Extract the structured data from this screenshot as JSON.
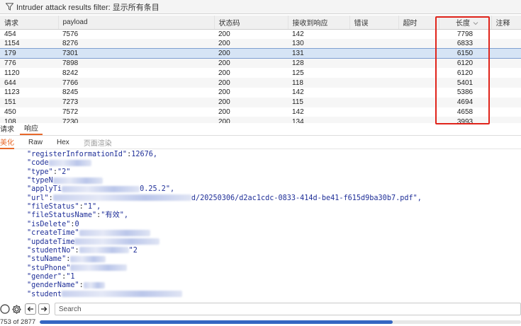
{
  "filter": {
    "icon": "funnel-icon",
    "label": "Intruder attack results filter: 显示所有条目"
  },
  "table": {
    "headers": [
      "请求",
      "payload",
      "状态码",
      "接收到响应",
      "错误",
      "超时",
      "长度",
      "注释"
    ],
    "sort_column": "长度",
    "sort_direction": "descending",
    "rows": [
      [
        "454",
        "7576",
        "200",
        "142",
        "",
        "",
        "7798",
        ""
      ],
      [
        "1154",
        "8276",
        "200",
        "130",
        "",
        "",
        "6833",
        ""
      ],
      [
        "179",
        "7301",
        "200",
        "131",
        "",
        "",
        "6150",
        ""
      ],
      [
        "776",
        "7898",
        "200",
        "128",
        "",
        "",
        "6120",
        ""
      ],
      [
        "1120",
        "8242",
        "200",
        "125",
        "",
        "",
        "6120",
        ""
      ],
      [
        "644",
        "7766",
        "200",
        "118",
        "",
        "",
        "5401",
        ""
      ],
      [
        "1123",
        "8245",
        "200",
        "142",
        "",
        "",
        "5386",
        ""
      ],
      [
        "151",
        "7273",
        "200",
        "115",
        "",
        "",
        "4694",
        ""
      ],
      [
        "450",
        "7572",
        "200",
        "142",
        "",
        "",
        "4658",
        ""
      ],
      [
        "108",
        "7230",
        "200",
        "134",
        "",
        "",
        "3993",
        ""
      ]
    ],
    "selected_row": 2,
    "highlight_color": "#e0241b"
  },
  "message_tabs": [
    "请求",
    "响应"
  ],
  "message_active": "响应",
  "view_tabs": [
    "美化",
    "Raw",
    "Hex",
    "页面渲染"
  ],
  "view_active": "美化",
  "body_lines": [
    {
      "key": "\"registerInformationId\"",
      "sep": ":",
      "value": "12676,",
      "blur": 0
    },
    {
      "key": "\"code",
      "sep": "",
      "value": "",
      "blur": 60
    },
    {
      "key": "\"type\"",
      "sep": ":",
      "value": "\"2\"",
      "blur": 0
    },
    {
      "key": "\"typeN",
      "sep": "",
      "value": "",
      "blur": 70
    },
    {
      "key": "\"applyTi",
      "sep": "",
      "value": "0.25.2\",",
      "blur": 110
    },
    {
      "key": "\"url\"",
      "sep": ":",
      "value": "d/20250306/d2ac1cdc-0833-414d-be41-f615d9ba30b7.pdf\",",
      "blur": 195
    },
    {
      "key": "\"fileStatus\"",
      "sep": ":",
      "value": "\"1\",",
      "blur": 0
    },
    {
      "key": "\"fileStatusName\"",
      "sep": ":",
      "value": "\"有效\",",
      "blur": 0
    },
    {
      "key": "\"isDelete\"",
      "sep": ":",
      "value": "0",
      "blur": 0
    },
    {
      "key": "\"createTime\"",
      "sep": "",
      "value": "",
      "blur": 100
    },
    {
      "key": "\"updateTime",
      "sep": "",
      "value": "",
      "blur": 120
    },
    {
      "key": "\"studentNo\"",
      "sep": ":",
      "value": "\"2",
      "blur": 70
    },
    {
      "key": "\"stuName\"",
      "sep": ":",
      "value": "",
      "blur": 50
    },
    {
      "key": "\"stuPhone\"",
      "sep": "",
      "value": "",
      "blur": 80
    },
    {
      "key": "\"gender\"",
      "sep": ":",
      "value": "\"1",
      "blur": 0
    },
    {
      "key": "\"genderName\"",
      "sep": ":",
      "value": "",
      "blur": 30
    },
    {
      "key": "\"student",
      "sep": "",
      "value": "",
      "blur": 170
    }
  ],
  "search": {
    "placeholder": "Search"
  },
  "progress": {
    "label": "753 of 2877",
    "completed": 753,
    "total": 2877,
    "color": "#3566c2"
  }
}
